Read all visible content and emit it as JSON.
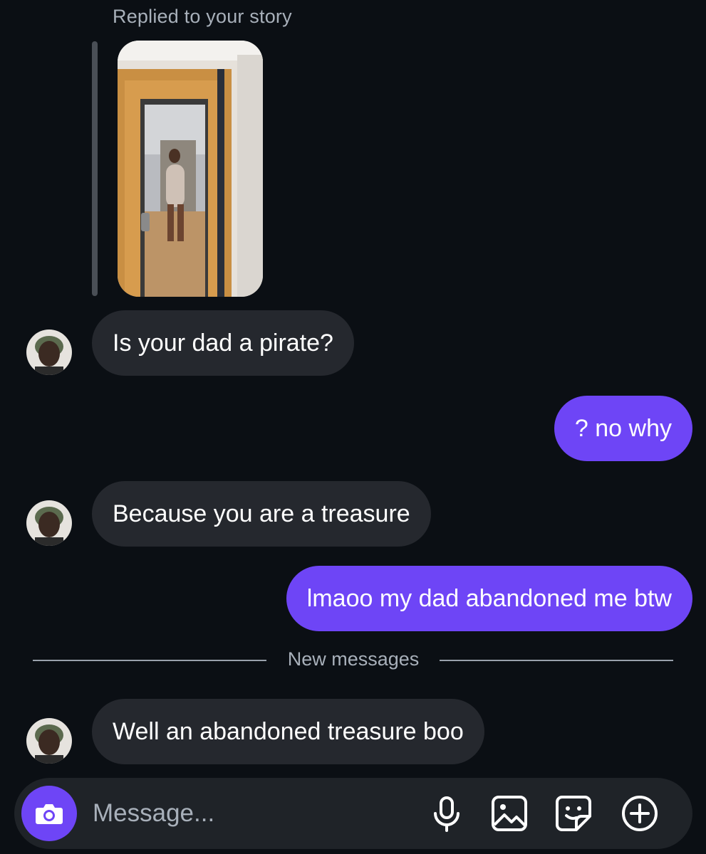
{
  "conversation": {
    "reply_caption": "Replied to your story",
    "story_thumbnail": "mirror-selfie-story-image",
    "new_messages_label": "New messages",
    "messages": [
      {
        "direction": "incoming",
        "text": "Is your dad a pirate?"
      },
      {
        "direction": "outgoing",
        "text": "? no why"
      },
      {
        "direction": "incoming",
        "text": "Because you are a treasure"
      },
      {
        "direction": "outgoing",
        "text": "lmaoo my dad abandoned me btw"
      },
      {
        "direction": "incoming",
        "text": "Well an abandoned treasure boo"
      }
    ]
  },
  "composer": {
    "placeholder": "Message...",
    "icons": [
      "camera-icon",
      "microphone-icon",
      "gallery-icon",
      "sticker-icon",
      "plus-circle-icon"
    ]
  },
  "colors": {
    "background": "#0b0f14",
    "incoming_bubble": "#25282e",
    "outgoing_bubble": "#6e45f6",
    "composer_bg": "#1f2328",
    "muted_text": "#a8b0ba"
  }
}
